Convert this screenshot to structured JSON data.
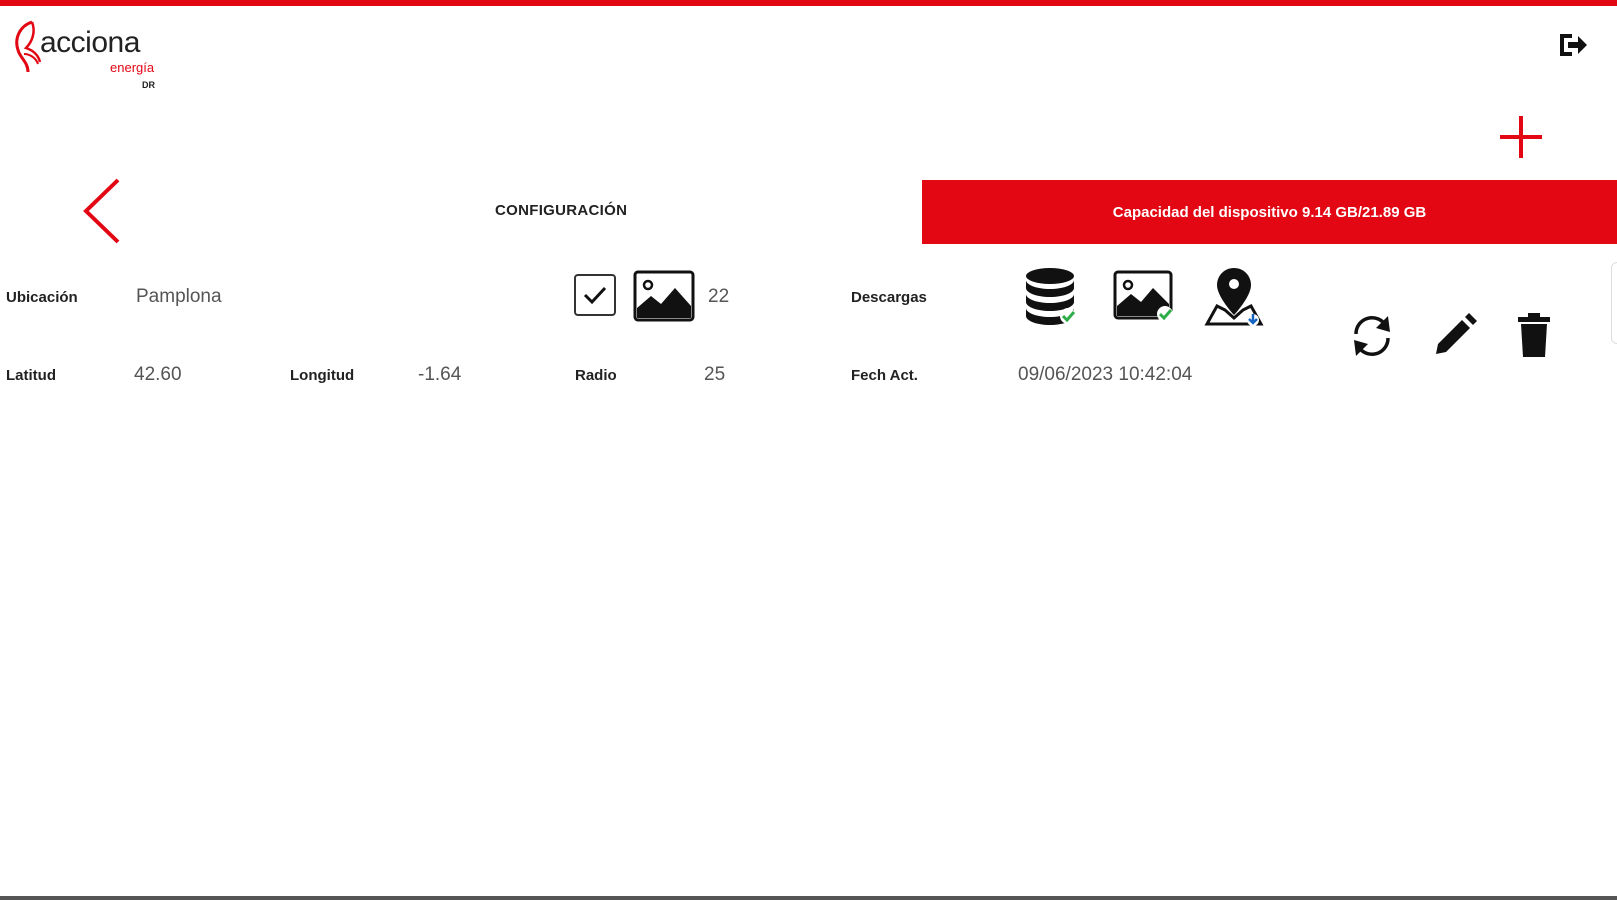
{
  "colors": {
    "brand": "#e30613",
    "bottom_bar": "#555555"
  },
  "header": {
    "logo": {
      "word": "acciona",
      "sub": "energía",
      "tag": "DR"
    },
    "exit_icon": "logout-icon",
    "add_icon": "plus-icon"
  },
  "nav": {
    "back_icon": "chevron-left-icon"
  },
  "section": {
    "title": "CONFIGURACIÓN",
    "capacity": "Capacidad del dispositivo 9.14 GB/21.89 GB"
  },
  "record": {
    "location_label": "Ubicación",
    "location_value": "Pamplona",
    "photos_checked": true,
    "photo_count": "22",
    "downloads_label": "Descargas",
    "download_icons": [
      "database-check-icon",
      "image-check-icon",
      "map-pin-download-icon"
    ],
    "lat_label": "Latitud",
    "lat_value": "42.60",
    "lon_label": "Longitud",
    "lon_value": "-1.64",
    "radius_label": "Radio",
    "radius_value": "25",
    "updated_label": "Fech Act.",
    "updated_value": "09/06/2023 10:42:04",
    "actions": [
      "sync-icon",
      "edit-icon",
      "trash-icon"
    ]
  }
}
